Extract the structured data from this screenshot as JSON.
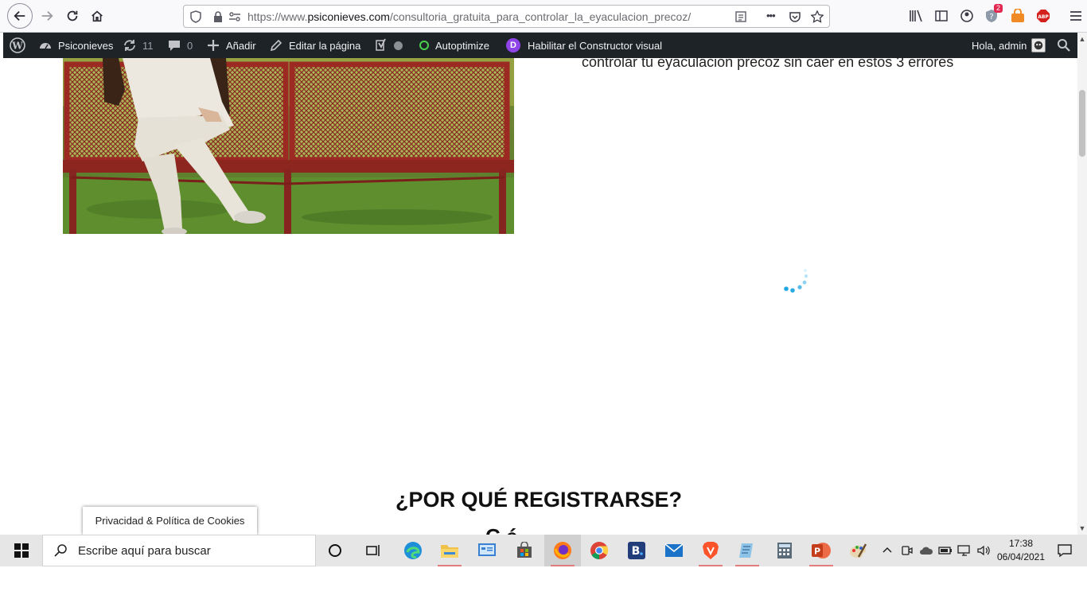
{
  "browser": {
    "url_prefix": "https://www.",
    "url_host": "psiconieves.com",
    "url_path": "/consultoria_gratuita_para_controlar_la_eyaculacion_precoz/",
    "ellipsis": "•••",
    "notification_badge": "2"
  },
  "wp_admin_bar": {
    "site_name": "Psiconieves",
    "updates_count": "11",
    "comments_count": "0",
    "add_label": "Añadir",
    "edit_page_label": "Editar la página",
    "autoptimize_label": "Autoptimize",
    "divi_letter": "D",
    "visual_builder_label": "Habilitar el Constructor visual",
    "greeting": "Hola, admin"
  },
  "content": {
    "hero_text": "controlar tu eyaculación precoz sin caer en estos 3 errores",
    "section_title": "¿POR QUÉ REGISTRARSE?",
    "cut_text": "C   é",
    "cookie_tab_label": "Privacidad & Política de Cookies"
  },
  "taskbar": {
    "search_placeholder": "Escribe aquí para buscar",
    "time": "17:38",
    "date": "06/04/2021",
    "icons": [
      "cortana-icon",
      "task-view-icon",
      "edge-icon",
      "file-explorer-icon",
      "control-panel-icon",
      "store-icon",
      "firefox-icon",
      "chrome-icon",
      "booking-icon",
      "mail-icon",
      "brave-icon",
      "notepad-icon",
      "calculator-icon",
      "powerpoint-icon",
      "paint-icon"
    ]
  },
  "colors": {
    "wp_bar_bg": "#1d2327",
    "taskbar_bg": "#e6e6e6",
    "spinner": "#1ea7e0",
    "divi_purple": "#8e44e8"
  }
}
